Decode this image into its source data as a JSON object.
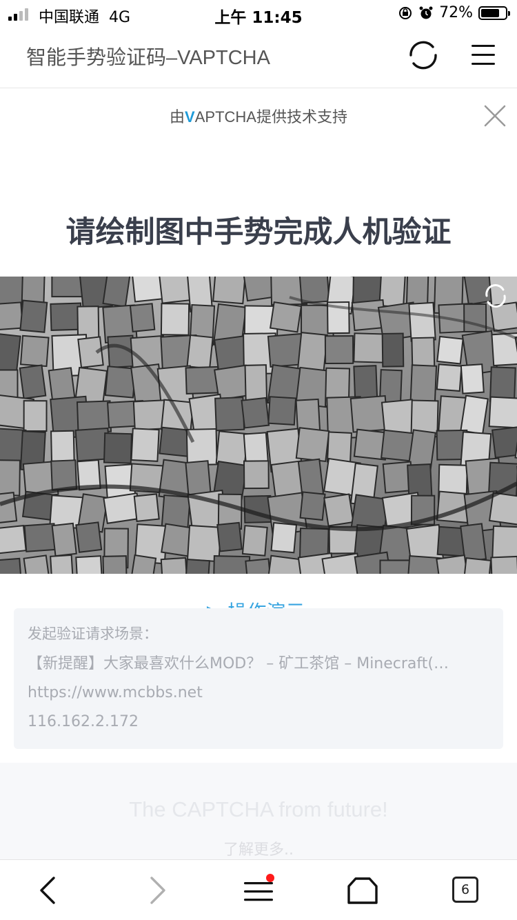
{
  "status_bar": {
    "carrier": "中国联通",
    "network": "4G",
    "time": "上午 11:45",
    "battery": "72%"
  },
  "header": {
    "title": "智能手势验证码–VAPTCHA",
    "refresh_icon": "refresh-icon",
    "menu_icon": "hamburger-menu-icon"
  },
  "captcha": {
    "powered_prefix": "由",
    "powered_brand_v": "V",
    "powered_brand_rest": "APTCHA",
    "powered_suffix": "提供技术支持",
    "instruction": "请绘制图中手势完成人机验证",
    "demo_link": "▷ 操作演示",
    "brand_color": "#1e9bd9"
  },
  "info": {
    "label": "发起验证请求场景：",
    "page_title": "【新提醒】大家最喜欢什么MOD？ – 矿工茶馆 – Minecraft(…",
    "url": "https://www.mcbbs.net",
    "ip": "116.162.2.172"
  },
  "footer": {
    "tagline": "The CAPTCHA from future!",
    "learn_more": "了解更多.."
  },
  "toolbar": {
    "tab_count": "6",
    "menu_badge_color": "#ff1a1a"
  }
}
